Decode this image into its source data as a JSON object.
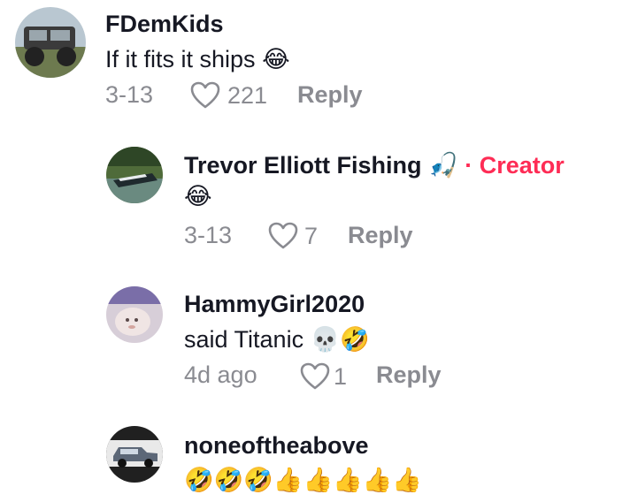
{
  "comments": [
    {
      "username": "FDemKids",
      "text": "If it fits it ships",
      "emoji": "😂",
      "date": "3-13",
      "likes": "221",
      "reply_label": "Reply"
    },
    {
      "username": "Trevor Elliott Fishing",
      "username_emoji": "🎣",
      "separator": "·",
      "badge": "Creator",
      "text": "",
      "emoji": "😂",
      "date": "3-13",
      "likes": "7",
      "reply_label": "Reply"
    },
    {
      "username": "HammyGirl2020",
      "text": "said Titanic",
      "emoji": "💀🤣",
      "date": "4d ago",
      "likes": "1",
      "reply_label": "Reply"
    },
    {
      "username": "noneoftheabove",
      "text": "",
      "emoji": "🤣🤣🤣👍👍👍👍👍"
    }
  ],
  "colors": {
    "text": "#161823",
    "muted": "#8a8b91",
    "creator": "#fe2c55"
  }
}
